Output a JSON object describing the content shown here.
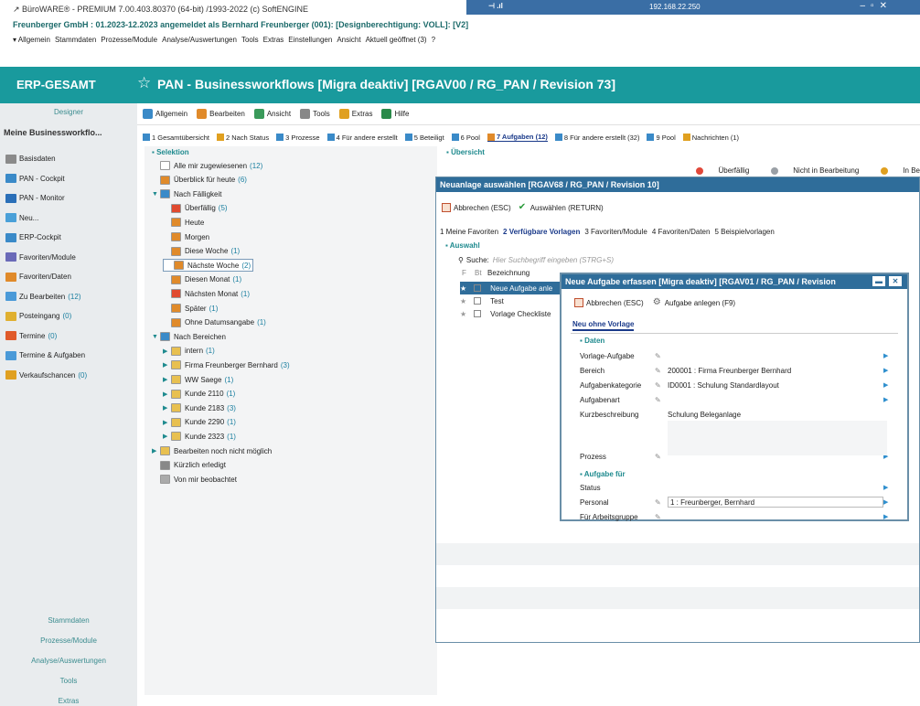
{
  "window": {
    "app_title": "↗ BüroWARE® - PREMIUM 7.00.403.80370 (64-bit) /1993-2022 (c) SoftENGINE",
    "remote_ip": "192.168.22.250",
    "company_line": "Freunberger GmbH : 01.2023-12.2023 angemeldet als Bernhard Freunberger (001): [Designberechtigung: VOLL]: [V2]"
  },
  "menubar": [
    "▾ Allgemein",
    "Stammdaten",
    "Prozesse/Module",
    "Analyse/Auswertungen",
    "Tools",
    "Extras",
    "Einstellungen",
    "Ansicht",
    "Aktuell geöffnet (3)",
    "?"
  ],
  "header": {
    "erp": "ERP-GESAMT",
    "title": "PAN - Businessworkflows [Migra deaktiv] [RGAV00 / RG_PAN / Revision 73]"
  },
  "sidebar": {
    "designer": "Designer",
    "section": "Meine Businessworkflo...",
    "items": [
      {
        "label": "Basisdaten",
        "count": "",
        "color": "#8a8a8a"
      },
      {
        "label": "PAN - Cockpit",
        "count": "",
        "color": "#3a8ac8"
      },
      {
        "label": "PAN - Monitor",
        "count": "",
        "color": "#2a6fb8"
      },
      {
        "label": "Neu...",
        "count": "",
        "color": "#4aa0d8"
      },
      {
        "label": "ERP-Cockpit",
        "count": "",
        "color": "#3a8ac8"
      },
      {
        "label": "Favoriten/Module",
        "count": "",
        "color": "#6a6ab8"
      },
      {
        "label": "Favoriten/Daten",
        "count": "",
        "color": "#e08a2a"
      },
      {
        "label": "Zu Bearbeiten",
        "count": "(12)",
        "color": "#4a9ad8"
      },
      {
        "label": "Posteingang",
        "count": "(0)",
        "color": "#e0b030"
      },
      {
        "label": "Termine",
        "count": "(0)",
        "color": "#e05a2a"
      },
      {
        "label": "Termine & Aufgaben",
        "count": "",
        "color": "#4a9ad8"
      },
      {
        "label": "Verkaufschancen",
        "count": "(0)",
        "color": "#e0a020"
      }
    ],
    "bottom": [
      "Stammdaten",
      "Prozesse/Module",
      "Analyse/Auswertungen",
      "Tools",
      "Extras"
    ]
  },
  "toolbar": [
    "Allgemein",
    "Bearbeiten",
    "Ansicht",
    "Tools",
    "Extras",
    "Hilfe"
  ],
  "tabs": [
    {
      "label": "1 Gesamtübersicht",
      "active": false
    },
    {
      "label": "2 Nach Status",
      "active": false
    },
    {
      "label": "3 Prozesse",
      "active": false
    },
    {
      "label": "4 Für andere erstellt",
      "active": false
    },
    {
      "label": "5 Beteiligt",
      "active": false
    },
    {
      "label": "6 Pool",
      "active": false
    },
    {
      "label": "7 Aufgaben (12)",
      "active": true
    },
    {
      "label": "8 Für andere erstellt (32)",
      "active": false
    },
    {
      "label": "9 Pool",
      "active": false
    },
    {
      "label": "Nachrichten (1)",
      "active": false
    }
  ],
  "tree": {
    "header": "Selektion",
    "nodes": [
      {
        "label": "Alle mir zugewiesenen",
        "count": "(12)",
        "indent": 0,
        "arrow": ""
      },
      {
        "label": "Überblick für heute",
        "count": "(6)",
        "indent": 0,
        "arrow": ""
      },
      {
        "label": "Nach Fälligkeit",
        "count": "",
        "indent": 0,
        "arrow": "▼"
      },
      {
        "label": "Überfällig",
        "count": "(5)",
        "indent": 1,
        "arrow": ""
      },
      {
        "label": "Heute",
        "count": "",
        "indent": 1,
        "arrow": ""
      },
      {
        "label": "Morgen",
        "count": "",
        "indent": 1,
        "arrow": ""
      },
      {
        "label": "Diese Woche",
        "count": "(1)",
        "indent": 1,
        "arrow": ""
      },
      {
        "label": "Nächste Woche",
        "count": "(2)",
        "indent": 1,
        "arrow": "",
        "selected": true
      },
      {
        "label": "Diesen Monat",
        "count": "(1)",
        "indent": 1,
        "arrow": ""
      },
      {
        "label": "Nächsten Monat",
        "count": "(1)",
        "indent": 1,
        "arrow": ""
      },
      {
        "label": "Später",
        "count": "(1)",
        "indent": 1,
        "arrow": ""
      },
      {
        "label": "Ohne Datumsangabe",
        "count": "(1)",
        "indent": 1,
        "arrow": ""
      },
      {
        "label": "Nach Bereichen",
        "count": "",
        "indent": 0,
        "arrow": "▼"
      },
      {
        "label": "intern",
        "count": "(1)",
        "indent": 1,
        "arrow": "▶"
      },
      {
        "label": "Firma Freunberger Bernhard",
        "count": "(3)",
        "indent": 1,
        "arrow": "▶"
      },
      {
        "label": "WW Saege",
        "count": "(1)",
        "indent": 1,
        "arrow": "▶"
      },
      {
        "label": "Kunde 2110",
        "count": "(1)",
        "indent": 1,
        "arrow": "▶"
      },
      {
        "label": "Kunde 2183",
        "count": "(3)",
        "indent": 1,
        "arrow": "▶"
      },
      {
        "label": "Kunde 2290",
        "count": "(1)",
        "indent": 1,
        "arrow": "▶"
      },
      {
        "label": "Kunde 2323",
        "count": "(1)",
        "indent": 1,
        "arrow": "▶"
      },
      {
        "label": "Bearbeiten noch nicht möglich",
        "count": "",
        "indent": 0,
        "arrow": "▶"
      },
      {
        "label": "Kürzlich erledigt",
        "count": "",
        "indent": 0,
        "arrow": ""
      },
      {
        "label": "Von mir beobachtet",
        "count": "",
        "indent": 0,
        "arrow": ""
      }
    ]
  },
  "uebersicht": {
    "header": "Übersicht",
    "legend": [
      {
        "label": "Überfällig",
        "color": "#e0483a"
      },
      {
        "label": "Nicht in Bearbeitung",
        "color": "#9aa0a6"
      },
      {
        "label": "In Be",
        "color": "#e0a020"
      }
    ]
  },
  "dialog1": {
    "title": "Neuanlage auswählen [RGAV68 / RG_PAN / Revision 10]",
    "cancel": "Abbrechen (ESC)",
    "select": "Auswählen (RETURN)",
    "tabs": [
      {
        "label": "1 Meine Favoriten",
        "active": false
      },
      {
        "label": "2 Verfügbare Vorlagen",
        "active": true
      },
      {
        "label": "3 Favoriten/Module",
        "active": false
      },
      {
        "label": "4 Favoriten/Daten",
        "active": false
      },
      {
        "label": "5 Beispielvorlagen",
        "active": false
      }
    ],
    "section": "Auswahl",
    "search_label": "Suche:",
    "search_placeholder": "Hier Suchbegriff eingeben (STRG+S)",
    "col_f": "F",
    "col_bt": "Bt",
    "col_bez": "Bezeichnung",
    "rows": [
      {
        "label": "Neue Aufgabe anle",
        "selected": true
      },
      {
        "label": "Test",
        "selected": false
      },
      {
        "label": "Vorlage Checkliste",
        "selected": false
      }
    ]
  },
  "dialog2": {
    "title": "Neue Aufgabe erfassen [Migra deaktiv] [RGAV01 / RG_PAN / Revision",
    "cancel": "Abbrechen (ESC)",
    "create": "Aufgabe anlegen (F9)",
    "tab": "Neu ohne Vorlage",
    "section_data": "Daten",
    "section_for": "Aufgabe für",
    "fields": [
      {
        "label": "Vorlage-Aufgabe",
        "value": "",
        "pen": true,
        "dd": true
      },
      {
        "label": "Bereich",
        "value": "200001   : Firma Freunberger Bernhard",
        "pen": true,
        "dd": true
      },
      {
        "label": "Aufgabenkategorie",
        "value": "ID0001   : Schulung Standardlayout",
        "pen": true,
        "dd": true
      },
      {
        "label": "Aufgabenart",
        "value": "",
        "pen": true,
        "dd": true
      },
      {
        "label": "Kurzbeschreibung",
        "value": "Schulung Beleganlage",
        "pen": false,
        "dd": false
      },
      {
        "label": "Prozess",
        "value": "",
        "pen": true,
        "dd": true
      }
    ],
    "for_fields": [
      {
        "label": "Status",
        "value": "",
        "pen": false,
        "dd": true
      },
      {
        "label": "Personal",
        "value": "1                    : Freunberger, Bernhard",
        "pen": true,
        "dd": true
      },
      {
        "label": "Für Arbeitsgruppe",
        "value": "",
        "pen": true,
        "dd": true
      }
    ]
  }
}
